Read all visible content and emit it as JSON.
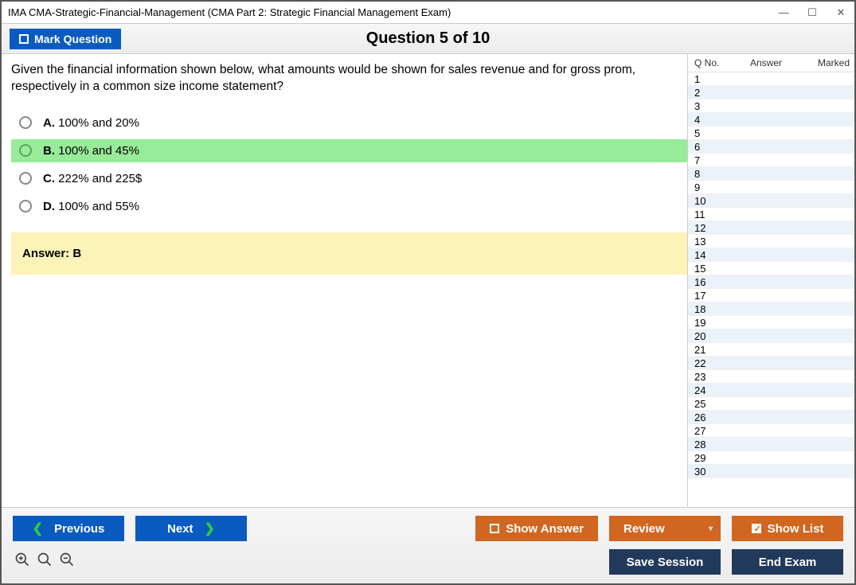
{
  "window_title": "IMA CMA-Strategic-Financial-Management (CMA Part 2: Strategic Financial Management Exam)",
  "toolbar": {
    "mark_label": "Mark Question",
    "question_header": "Question 5 of 10"
  },
  "question": {
    "text": "Given the financial information shown below, what amounts would be shown for sales revenue and for gross prom, respectively in a common size income statement?",
    "options": [
      {
        "letter": "A.",
        "text": "100% and 20%",
        "selected": false
      },
      {
        "letter": "B.",
        "text": "100% and 45%",
        "selected": true
      },
      {
        "letter": "C.",
        "text": "222% and 225$",
        "selected": false
      },
      {
        "letter": "D.",
        "text": "100% and 55%",
        "selected": false
      }
    ],
    "answer_label": "Answer: B"
  },
  "sidebar": {
    "headers": {
      "qno": "Q No.",
      "answer": "Answer",
      "marked": "Marked"
    },
    "rows": [
      1,
      2,
      3,
      4,
      5,
      6,
      7,
      8,
      9,
      10,
      11,
      12,
      13,
      14,
      15,
      16,
      17,
      18,
      19,
      20,
      21,
      22,
      23,
      24,
      25,
      26,
      27,
      28,
      29,
      30
    ]
  },
  "footer": {
    "previous": "Previous",
    "next": "Next",
    "show_answer": "Show Answer",
    "review": "Review",
    "show_list": "Show List",
    "save_session": "Save Session",
    "end_exam": "End Exam"
  }
}
